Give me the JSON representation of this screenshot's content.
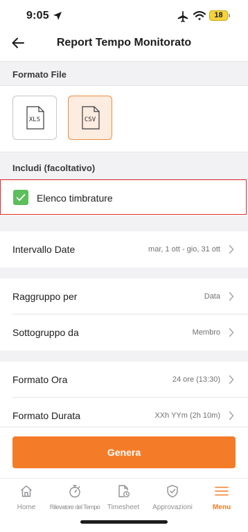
{
  "status_bar": {
    "time": "9:05",
    "battery": "18"
  },
  "header": {
    "title": "Report Tempo Monitorato"
  },
  "file_format": {
    "section_title": "Formato File",
    "options": [
      {
        "label": "XLS",
        "selected": false
      },
      {
        "label": "CSV",
        "selected": true
      }
    ]
  },
  "include": {
    "section_title": "Includi (facoltativo)",
    "option_label": "Elenco timbrature",
    "checked": true
  },
  "settings": {
    "date_range": {
      "label": "Intervallo Date",
      "value": "mar, 1 ott - gio, 31 ott"
    },
    "group_by": {
      "label": "Raggruppo per",
      "value": "Data"
    },
    "subgroup_by": {
      "label": "Sottogruppo da",
      "value": "Membro"
    },
    "time_format": {
      "label": "Formato Ora",
      "value": "24 ore (13:30)"
    },
    "duration_format": {
      "label": "Formato Durata",
      "value": "XXh YYm (2h 10m)"
    }
  },
  "generate_button": {
    "label": "Genera"
  },
  "tab_bar": {
    "tabs": [
      {
        "label": "Home",
        "icon": "home-icon"
      },
      {
        "label": "Rilevatore del Tempo",
        "icon": "stopwatch-icon"
      },
      {
        "label": "Timesheet",
        "icon": "timesheet-icon"
      },
      {
        "label": "Approvazioni",
        "icon": "shield-check-icon"
      },
      {
        "label": "Menu",
        "icon": "menu-icon"
      }
    ],
    "active_index": 4
  },
  "colors": {
    "accent": "#f47c28",
    "checkbox": "#5cbe5c",
    "highlight_border": "#e0262e",
    "selected_card_bg": "#fdece0"
  }
}
